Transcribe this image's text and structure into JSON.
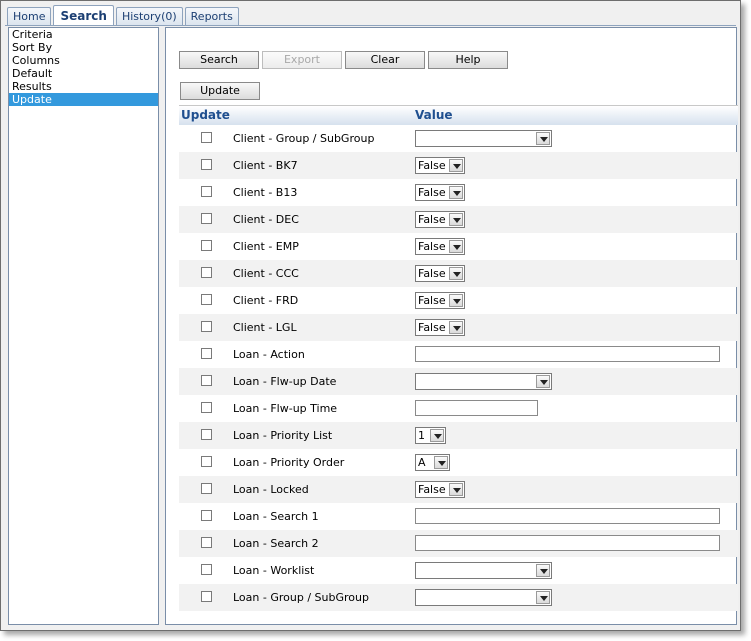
{
  "tabs": [
    {
      "label": "Home",
      "active": false
    },
    {
      "label": "Search",
      "active": true
    },
    {
      "label": "History(0)",
      "active": false
    },
    {
      "label": "Reports",
      "active": false
    }
  ],
  "leftnav": {
    "items": [
      "Criteria",
      "Sort By",
      "Columns",
      "Default",
      "Results",
      "Update"
    ],
    "selected": "Update"
  },
  "toolbar": {
    "search": "Search",
    "export": "Export",
    "clear": "Clear",
    "help": "Help",
    "update": "Update"
  },
  "table": {
    "headers": {
      "update": "Update",
      "value": "Value"
    },
    "rows": [
      {
        "label": "Client - Group / SubGroup",
        "control": "select-wide",
        "value": ""
      },
      {
        "label": "Client - BK7",
        "control": "select-small",
        "value": "False"
      },
      {
        "label": "Client - B13",
        "control": "select-small",
        "value": "False"
      },
      {
        "label": "Client - DEC",
        "control": "select-small",
        "value": "False"
      },
      {
        "label": "Client - EMP",
        "control": "select-small",
        "value": "False"
      },
      {
        "label": "Client - CCC",
        "control": "select-small",
        "value": "False"
      },
      {
        "label": "Client - FRD",
        "control": "select-small",
        "value": "False"
      },
      {
        "label": "Client - LGL",
        "control": "select-small",
        "value": "False"
      },
      {
        "label": "Loan - Action",
        "control": "text-long",
        "value": ""
      },
      {
        "label": "Loan - Flw-up Date",
        "control": "select-wide",
        "value": ""
      },
      {
        "label": "Loan - Flw-up Time",
        "control": "text-medium",
        "value": ""
      },
      {
        "label": "Loan - Priority List",
        "control": "select-tiny",
        "value": "1"
      },
      {
        "label": "Loan - Priority Order",
        "control": "select-tiny2",
        "value": "A"
      },
      {
        "label": "Loan - Locked",
        "control": "select-small",
        "value": "False"
      },
      {
        "label": "Loan - Search 1",
        "control": "text-long",
        "value": ""
      },
      {
        "label": "Loan - Search 2",
        "control": "text-long",
        "value": ""
      },
      {
        "label": "Loan - Worklist",
        "control": "select-wide",
        "value": ""
      },
      {
        "label": "Loan - Group / SubGroup",
        "control": "select-wide",
        "value": ""
      }
    ]
  },
  "colors": {
    "selected_bg": "#3399dd",
    "header_text": "#1f4f8f",
    "tab_text": "#1c3f73"
  }
}
